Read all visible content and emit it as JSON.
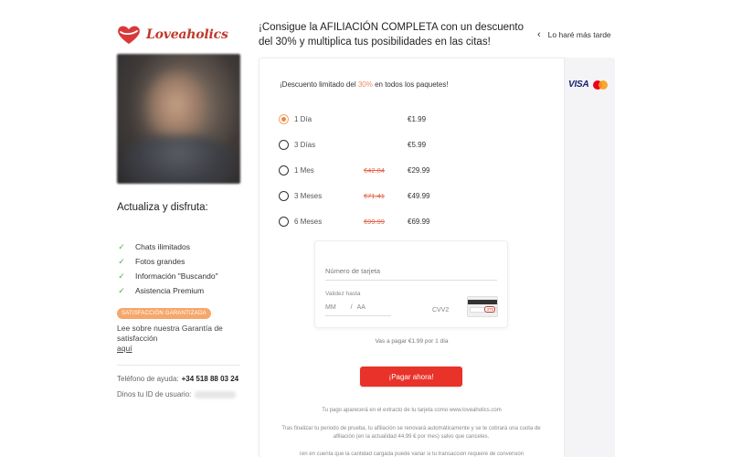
{
  "brand": {
    "name": "Loveaholics",
    "color": "#c0392b"
  },
  "accent_color": "#f0893c",
  "cta_color": "#e8322a",
  "headline": "¡Consigue la AFILIACIÓN COMPLETA con un descuento del 30% y multiplica tus posibilidades en las citas!",
  "later_link": "Lo haré más tarde",
  "left_panel": {
    "enjoy_title": "Actualiza y disfruta:",
    "benefits": [
      "Chats ilimitados",
      "Fotos grandes",
      "Información \"Buscando\"",
      "Asistencia Premium"
    ],
    "guarantee_badge": "SATISFACCIÓN GARANTIZADA",
    "guarantee_text": "Lee sobre nuestra Garantía de satisfacción",
    "guarantee_link": "aquí",
    "help_label": "Teléfono de ayuda:",
    "help_phone": "+34 518 88 03 24",
    "user_id_label": "Dinos tu ID de usuario:"
  },
  "payment_logos": {
    "visa": "VISA",
    "mastercard": "mastercard-icon"
  },
  "promo": {
    "prefix": "¡Descuento limitado del ",
    "percent": "30%",
    "suffix": " en todos los paquetes!"
  },
  "plans": [
    {
      "label": "1 Día",
      "old_price": "",
      "price": "€1.99",
      "selected": true
    },
    {
      "label": "3 Días",
      "old_price": "",
      "price": "€5.99",
      "selected": false
    },
    {
      "label": "1 Mes",
      "old_price": "€42.84",
      "price": "€29.99",
      "selected": false
    },
    {
      "label": "3 Meses",
      "old_price": "€71.41",
      "price": "€49.99",
      "selected": false
    },
    {
      "label": "6 Meses",
      "old_price": "€99.99",
      "price": "€69.99",
      "selected": false
    }
  ],
  "card_form": {
    "number_placeholder": "Número de tarjeta",
    "expiry_label": "Validez hasta",
    "month_placeholder": "MM",
    "year_placeholder": "AA",
    "cvv_placeholder": "CVV2",
    "cvv_example": "375"
  },
  "pay_note": "Vas a pagar €1.99 por 1 día",
  "pay_button": "¡Pagar ahora!",
  "footer": {
    "statement": "Tu pago aparecerá en el extracto de tu tarjeta como www.loveaholics.com",
    "renewal": "Tras finalizar tu periodo de prueba, tu afiliación se renovará automáticamente y se te cobrará una cuota de afiliación (en la actualidad 44.99 € por mes) salvo que canceles.",
    "conversion": "Ten en cuenta que la cantidad cargada puede variar si tu transacción requiere de conversión"
  }
}
